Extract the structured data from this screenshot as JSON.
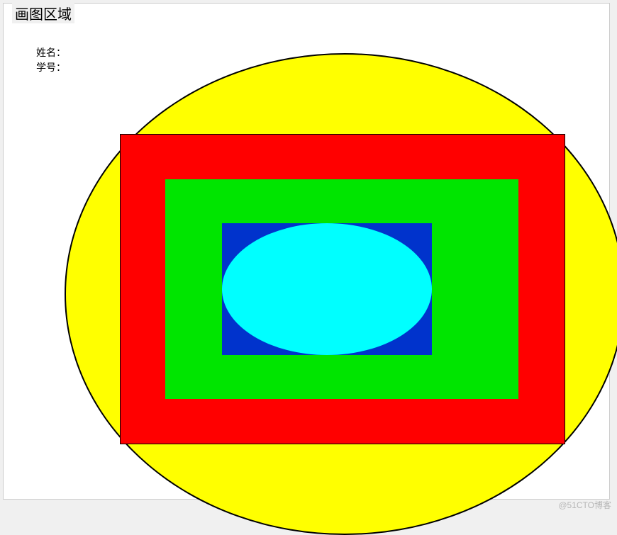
{
  "panel": {
    "title": "画图区域"
  },
  "info": {
    "name_label": "姓名：",
    "id_label": "学号："
  },
  "shapes": {
    "big_ellipse": {
      "fill": "#ffff00",
      "stroke": "#000000"
    },
    "red_rect": {
      "fill": "#ff0000",
      "stroke": "#000000"
    },
    "green_rect": {
      "fill": "#00e500"
    },
    "blue_rect": {
      "fill": "#0033cc"
    },
    "cyan_ellipse": {
      "fill": "#00ffff"
    }
  },
  "watermark": "@51CTO博客"
}
